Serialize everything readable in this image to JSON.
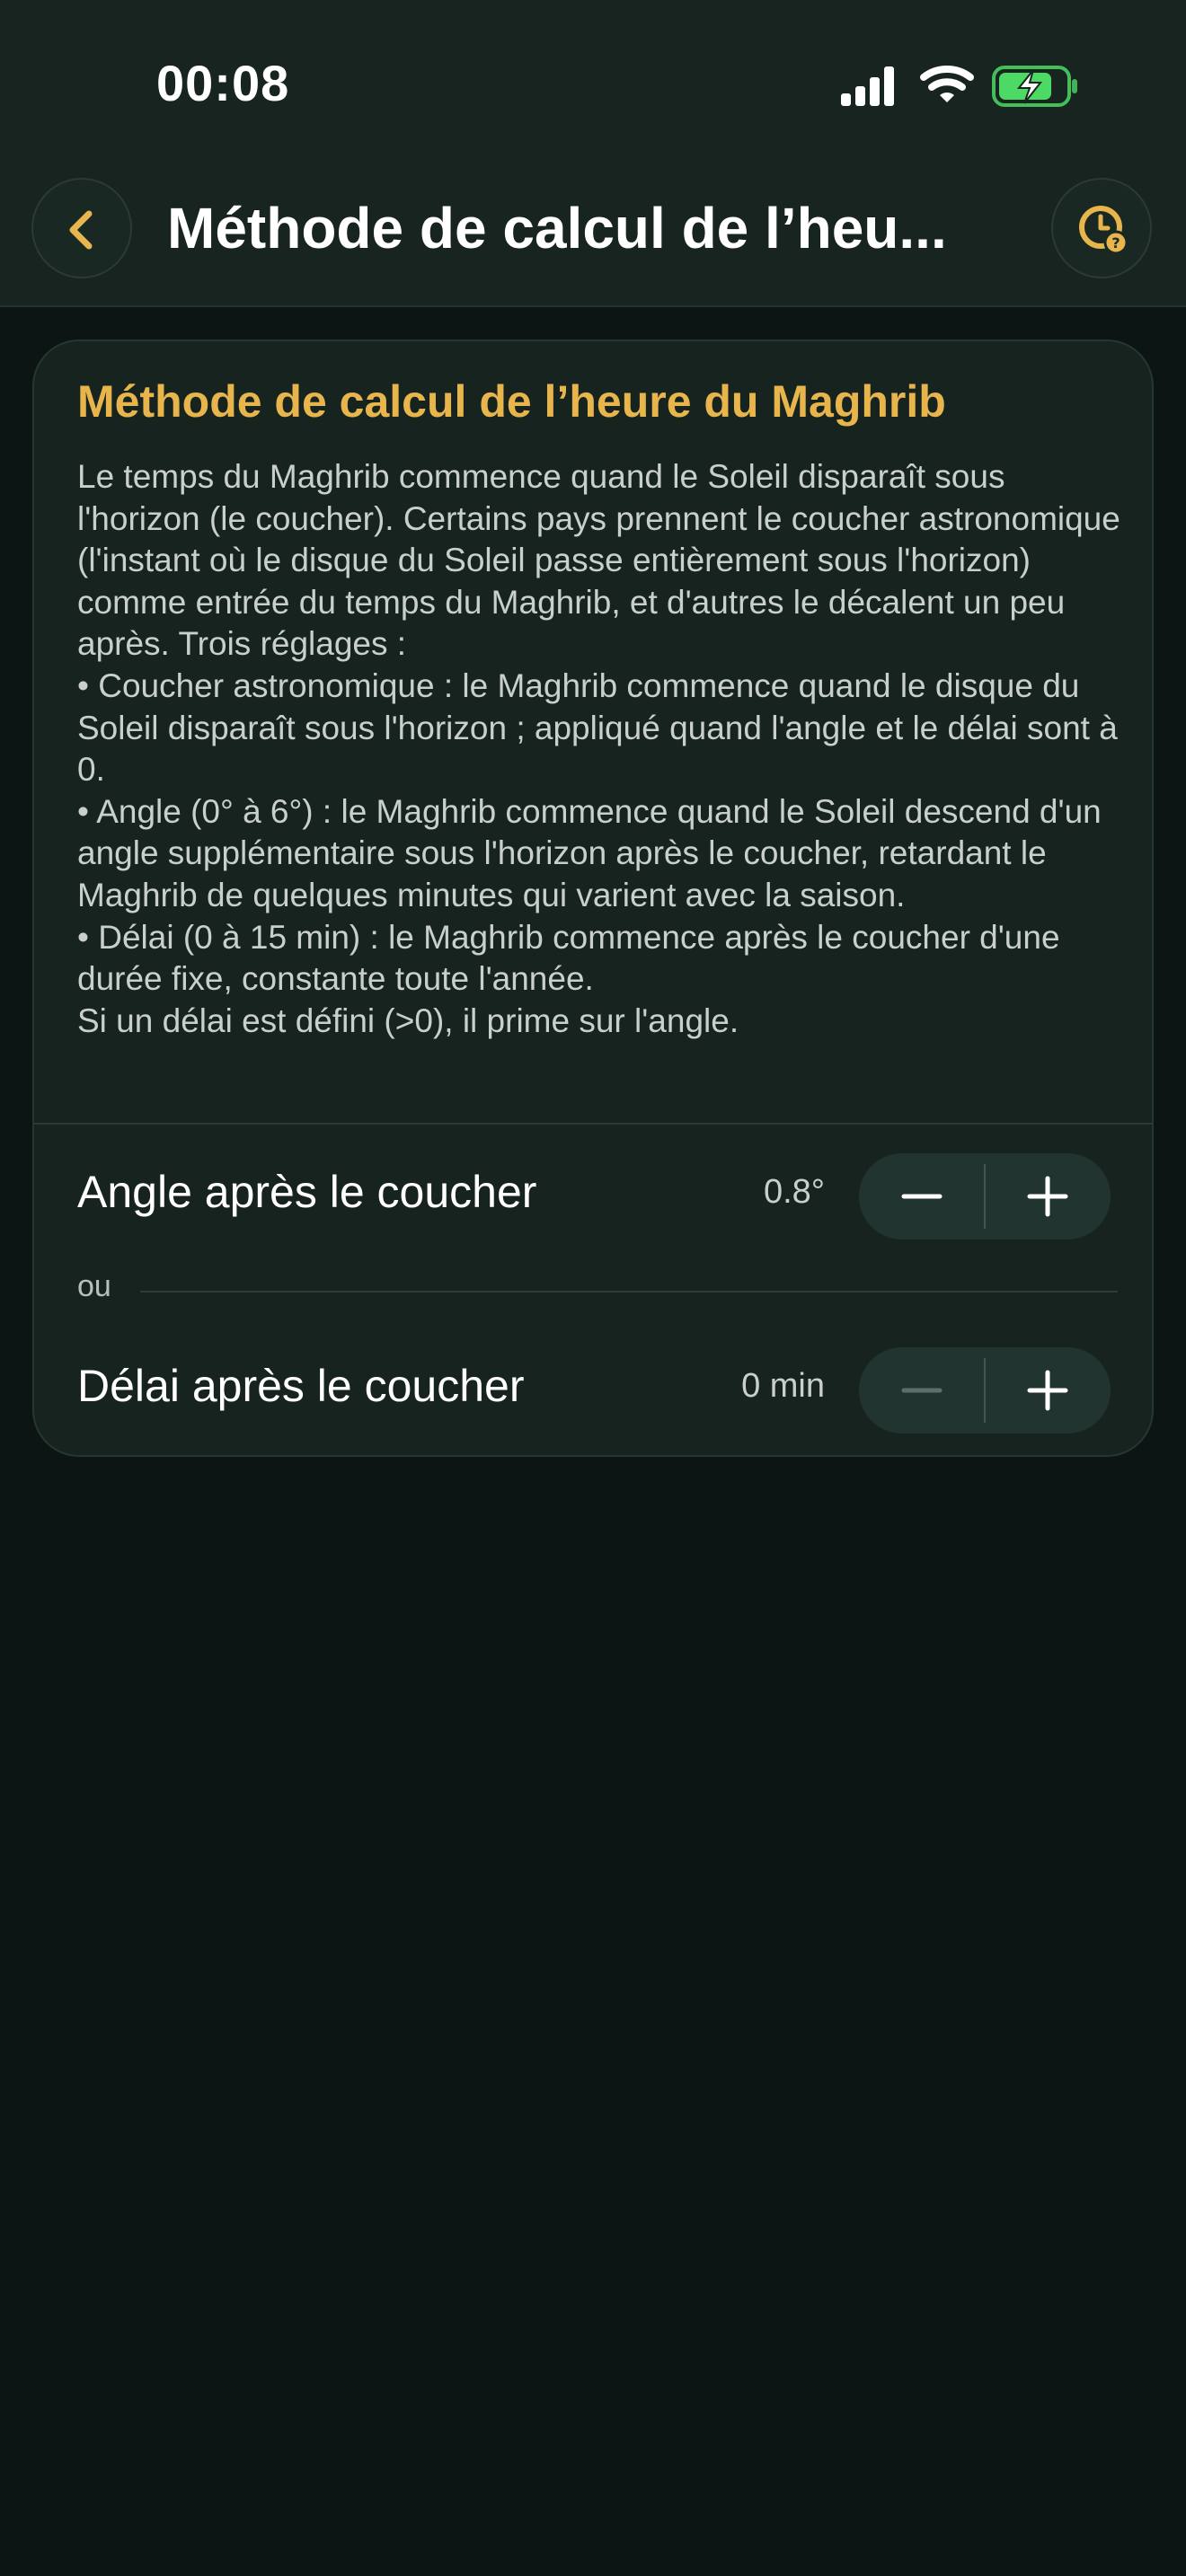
{
  "status_bar": {
    "time": "00:08",
    "icons": [
      "signal-icon",
      "wifi-icon",
      "battery-charging-icon"
    ],
    "battery_color": "#4cd964"
  },
  "nav": {
    "title": "Méthode de calcul de l’heu...",
    "back_icon": "chevron-left-icon",
    "help_icon": "clock-question-icon",
    "accent": "#e7b54c"
  },
  "card": {
    "title": "Méthode de calcul de l’heure du Maghrib",
    "description": "Le temps du Maghrib commence quand le Soleil disparaît sous l'horizon (le coucher). Certains pays prennent le coucher astronomique (l'instant où le disque du Soleil passe entièrement sous l'horizon) comme entrée du temps du Maghrib, et d'autres le décalent un peu après. Trois réglages :\n• Coucher astronomique : le Maghrib commence quand le disque du Soleil disparaît sous l'horizon ; appliqué quand l'angle et le délai sont à 0.\n• Angle (0° à 6°) : le Maghrib commence quand le Soleil descend d'un angle supplémentaire sous l'horizon après le coucher, retardant le Maghrib de quelques minutes qui varient avec la saison.\n• Délai (0 à 15 min) : le Maghrib commence après le coucher d'une durée fixe, constante toute l'année.\nSi un délai est défini (>0), il prime sur l'angle."
  },
  "settings": {
    "angle": {
      "label": "Angle après le coucher",
      "value": "0.8°",
      "minus_enabled": true,
      "plus_enabled": true
    },
    "separator_label": "ou",
    "delay": {
      "label": "Délai après le coucher",
      "value": "0 min",
      "minus_enabled": false,
      "plus_enabled": true
    }
  }
}
